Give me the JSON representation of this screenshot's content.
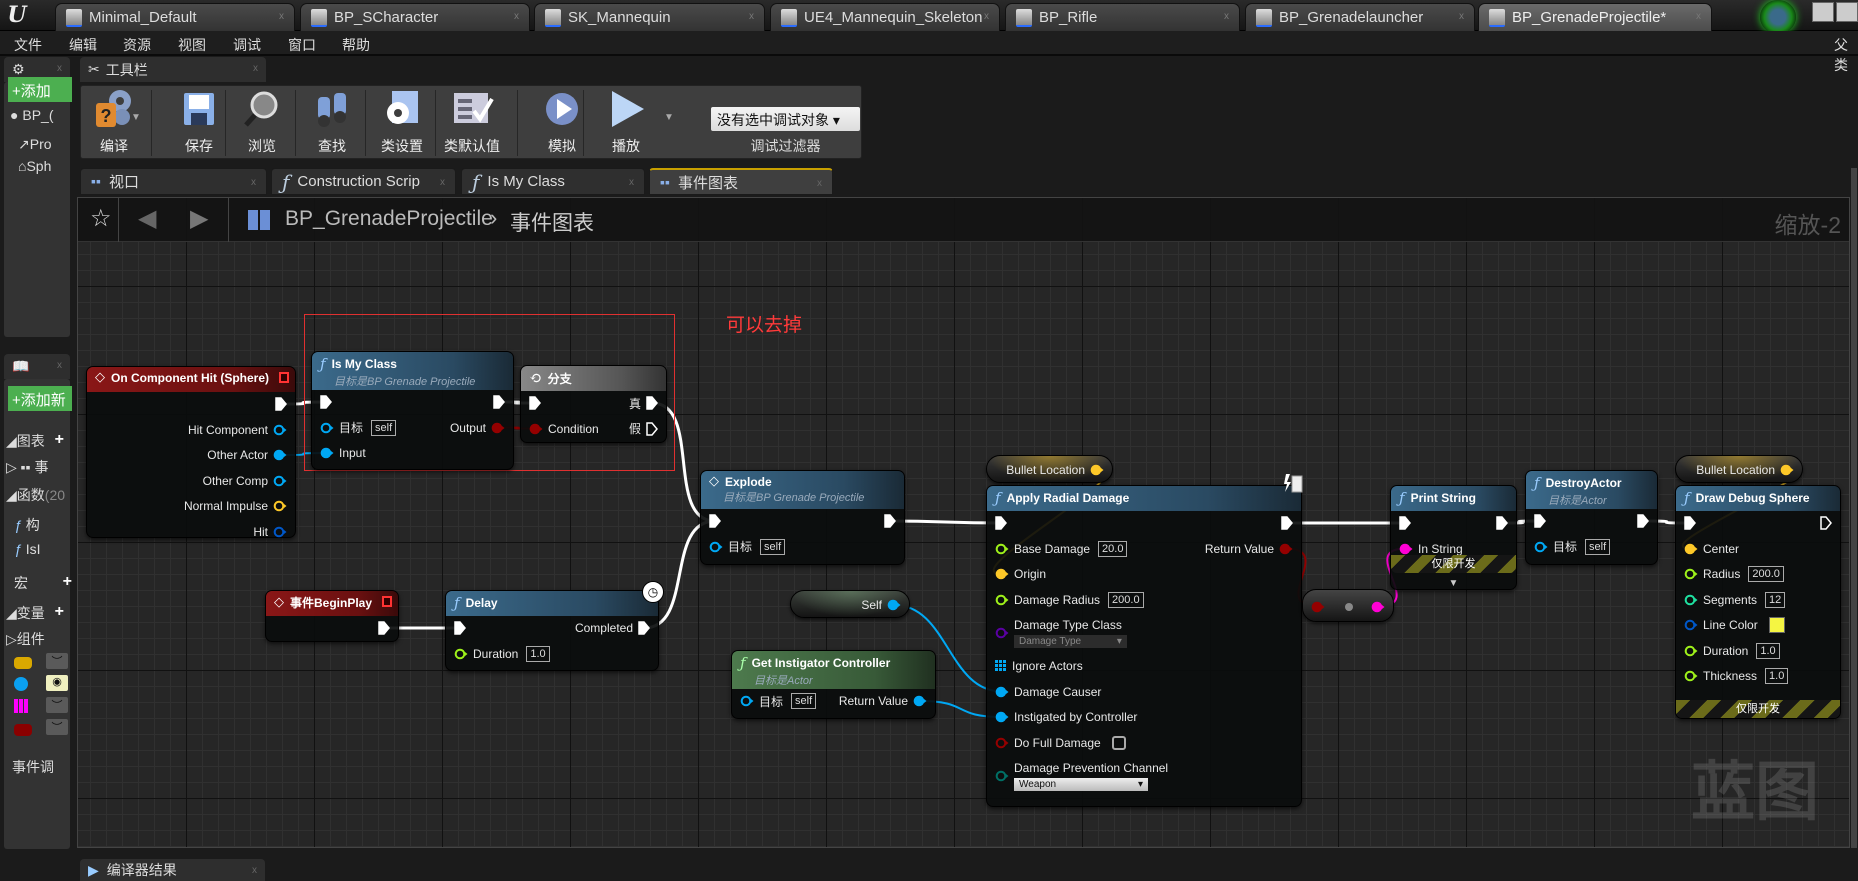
{
  "top_tabs": [
    {
      "label": "Minimal_Default",
      "icon": "level-icon"
    },
    {
      "label": "BP_SCharacter",
      "icon": "blueprint-icon"
    },
    {
      "label": "SK_Mannequin",
      "icon": "skeletal-mesh-icon"
    },
    {
      "label": "UE4_Mannequin_Skeleton",
      "icon": "skeleton-icon"
    },
    {
      "label": "BP_Rifle",
      "icon": "blueprint-icon"
    },
    {
      "label": "BP_Grenadelauncher",
      "icon": "blueprint-icon"
    },
    {
      "label": "BP_GrenadeProjectile*",
      "icon": "blueprint-icon",
      "active": true
    }
  ],
  "menu": [
    "文件",
    "编辑",
    "资源",
    "视图",
    "调试",
    "窗口",
    "帮助"
  ],
  "menu_right": "父类",
  "toolbar": {
    "tab": "工具栏",
    "buttons": [
      {
        "label": "编译",
        "icon": "compile-icon"
      },
      {
        "label": "保存",
        "icon": "save-icon"
      },
      {
        "label": "浏览",
        "icon": "browse-icon"
      },
      {
        "label": "查找",
        "icon": "find-icon"
      },
      {
        "label": "类设置",
        "icon": "class-settings-icon"
      },
      {
        "label": "类默认值",
        "icon": "class-defaults-icon"
      },
      {
        "label": "模拟",
        "icon": "simulate-icon"
      },
      {
        "label": "播放",
        "icon": "play-icon"
      }
    ],
    "debug_select": "没有选中调试对象",
    "debug_label": "调试过滤器"
  },
  "doc_tabs": [
    {
      "label": "视口",
      "icon": "viewport-icon"
    },
    {
      "label": "Construction Scrip",
      "icon": "function-icon"
    },
    {
      "label": "Is My Class",
      "icon": "function-icon"
    },
    {
      "label": "事件图表",
      "icon": "event-graph-icon",
      "active": true
    }
  ],
  "breadcrumb": {
    "blueprint": "BP_GrenadeProjectile",
    "separator": "›",
    "graph": "事件图表"
  },
  "zoom_label": "缩放-2",
  "watermark": "蓝图",
  "comment": "可以去掉",
  "left_panel": {
    "components": {
      "add": "+添加",
      "items": [
        "BP_(",
        "Pro",
        "Sph"
      ]
    },
    "my_blueprint": {
      "add": "+添加新",
      "graphs": "◢图表",
      "graph_item": "事",
      "functions": "◢函数",
      "functions_count": "(20",
      "function_items": [
        "构",
        "IsI"
      ],
      "macros": "宏",
      "variables": "◢变量",
      "components": "▷组件",
      "dispatchers": "事件调"
    }
  },
  "bottom_tab": "编译器结果",
  "pin_colors": {
    "exec": "#ffffff",
    "object": "#00a8f4",
    "struct": "#0057c8",
    "vector": "#fdc828",
    "float": "#9ef01a",
    "int": "#1fe0a0",
    "bool": "#950000",
    "string": "#ff00d4",
    "class": "#5a00a3",
    "enum": "#006f65",
    "array": "#00a8f4"
  },
  "graph": {
    "nodes": {
      "och": {
        "kind": "event",
        "title": "On Component Hit (Sphere)",
        "rows": [
          {
            "r": {
              "type": "exec"
            }
          },
          {
            "r": {
              "label": "Hit Component",
              "type": "object"
            }
          },
          {
            "r": {
              "label": "Other Actor",
              "type": "object"
            }
          },
          {
            "r": {
              "label": "Other Comp",
              "type": "object"
            }
          },
          {
            "r": {
              "label": "Normal Impulse",
              "type": "vector"
            }
          },
          {
            "r": {
              "label": "Hit",
              "type": "struct"
            }
          }
        ]
      },
      "imc": {
        "kind": "function",
        "title": "Is My Class",
        "subtitle": "目标是BP Grenade Projectile",
        "rows": [
          {
            "l": {
              "type": "exec"
            },
            "r": {
              "type": "exec"
            }
          },
          {
            "l": {
              "label": "目标",
              "type": "object",
              "value": "self"
            },
            "r": {
              "label": "Output",
              "type": "bool"
            }
          },
          {
            "l": {
              "label": "Input",
              "type": "object"
            }
          }
        ]
      },
      "branch": {
        "kind": "branch",
        "title": "分支",
        "rows": [
          {
            "l": {
              "type": "exec"
            },
            "r": {
              "label": "真",
              "type": "exec"
            }
          },
          {
            "l": {
              "label": "Condition",
              "type": "bool"
            },
            "r": {
              "label": "假",
              "type": "exec"
            }
          }
        ]
      },
      "explode": {
        "kind": "function",
        "icon": "event",
        "title": "Explode",
        "subtitle": "目标是BP Grenade Projectile",
        "rows": [
          {
            "l": {
              "type": "exec"
            },
            "r": {
              "type": "exec"
            }
          },
          {
            "l": {
              "label": "目标",
              "type": "object",
              "value": "self"
            }
          }
        ]
      },
      "beginplay": {
        "kind": "event",
        "title": "事件BeginPlay",
        "rows": [
          {
            "r": {
              "type": "exec"
            }
          }
        ]
      },
      "delay": {
        "kind": "function",
        "title": "Delay",
        "latent": true,
        "rows": [
          {
            "l": {
              "type": "exec"
            },
            "r": {
              "label": "Completed",
              "type": "exec"
            }
          },
          {
            "l": {
              "label": "Duration",
              "type": "float",
              "value": "1.0"
            }
          }
        ]
      },
      "self": {
        "kind": "var",
        "var_type": "object",
        "rows": [
          {
            "r": {
              "label": "Self",
              "type": "object"
            }
          }
        ]
      },
      "gic": {
        "kind": "pure",
        "title": "Get Instigator Controller",
        "subtitle": "目标是Actor",
        "rows": [
          {
            "l": {
              "label": "目标",
              "type": "object",
              "value": "self"
            },
            "r": {
              "label": "Return Value",
              "type": "object"
            }
          }
        ]
      },
      "bullet1": {
        "kind": "var",
        "var_type": "vector",
        "rows": [
          {
            "r": {
              "label": "Bullet Location",
              "type": "vector"
            }
          }
        ]
      },
      "ard": {
        "kind": "function",
        "title": "Apply Radial Damage",
        "authority_only": true,
        "rows": [
          {
            "l": {
              "type": "exec"
            },
            "r": {
              "type": "exec"
            }
          },
          {
            "l": {
              "label": "Base Damage",
              "type": "float",
              "value": "20.0"
            },
            "r": {
              "label": "Return Value",
              "type": "bool"
            }
          },
          {
            "l": {
              "label": "Origin",
              "type": "vector"
            }
          },
          {
            "l": {
              "label": "Damage Radius",
              "type": "float",
              "value": "200.0"
            }
          },
          {
            "l": {
              "label": "Damage Type Class",
              "type": "class",
              "dropdown": "Damage Type",
              "dim": true
            }
          },
          {
            "l": {
              "label": "Ignore Actors",
              "type": "array"
            }
          },
          {
            "l": {
              "label": "Damage Causer",
              "type": "object"
            }
          },
          {
            "l": {
              "label": "Instigated by Controller",
              "type": "object"
            }
          },
          {
            "l": {
              "label": "Do Full Damage",
              "type": "bool",
              "checkbox": false
            }
          },
          {
            "l": {
              "label": "Damage Prevention Channel",
              "type": "enum",
              "dropdown": "Weapon"
            }
          }
        ]
      },
      "reroute": {
        "kind": "conv",
        "rows": [
          {
            "l": {
              "type": "bool"
            },
            "r": {
              "type": "string"
            }
          }
        ]
      },
      "print": {
        "kind": "function",
        "title": "Print String",
        "footer": "仅限开发",
        "expand": true,
        "rows": [
          {
            "l": {
              "type": "exec"
            },
            "r": {
              "type": "exec"
            }
          },
          {
            "l": {
              "label": "In String",
              "type": "string"
            }
          }
        ]
      },
      "destroy": {
        "kind": "function",
        "title": "DestroyActor",
        "subtitle": "目标是Actor",
        "rows": [
          {
            "l": {
              "type": "exec"
            },
            "r": {
              "type": "exec"
            }
          },
          {
            "l": {
              "label": "目标",
              "type": "object",
              "value": "self"
            }
          }
        ]
      },
      "bullet2": {
        "kind": "var",
        "var_type": "vector",
        "rows": [
          {
            "r": {
              "label": "Bullet Location",
              "type": "vector"
            }
          }
        ]
      },
      "dds": {
        "kind": "function",
        "title": "Draw Debug Sphere",
        "footer": "仅限开发",
        "rows": [
          {
            "l": {
              "type": "exec"
            },
            "r": {
              "type": "exec"
            }
          },
          {
            "l": {
              "label": "Center",
              "type": "vector"
            }
          },
          {
            "l": {
              "label": "Radius",
              "type": "float",
              "value": "200.0"
            }
          },
          {
            "l": {
              "label": "Segments",
              "type": "int",
              "value": "12"
            }
          },
          {
            "l": {
              "label": "Line Color",
              "type": "struct",
              "color": "#f5f542"
            }
          },
          {
            "l": {
              "label": "Duration",
              "type": "float",
              "value": "1.0"
            }
          },
          {
            "l": {
              "label": "Thickness",
              "type": "float",
              "value": "1.0"
            }
          }
        ]
      }
    },
    "connections": [
      {
        "from": "och:0:r",
        "to": "imc:0:l",
        "type": "exec"
      },
      {
        "from": "och:2:r",
        "to": "imc:2:l",
        "type": "object"
      },
      {
        "from": "imc:0:r",
        "to": "branch:0:l",
        "type": "exec"
      },
      {
        "from": "imc:1:r",
        "to": "branch:1:l",
        "type": "bool"
      },
      {
        "from": "branch:0:r",
        "to": "explode:0:l",
        "type": "exec"
      },
      {
        "from": "beginplay:0:r",
        "to": "delay:0:l",
        "type": "exec"
      },
      {
        "from": "delay:0:r",
        "to": "explode:0:l",
        "type": "exec"
      },
      {
        "from": "explode:0:r",
        "to": "ard:0:l",
        "type": "exec"
      },
      {
        "from": "bullet1:0:r",
        "to": "ard:2:l",
        "type": "vector"
      },
      {
        "from": "self:0:r",
        "to": "ard:6:l",
        "type": "object"
      },
      {
        "from": "gic:0:r",
        "to": "ard:7:l",
        "type": "object"
      },
      {
        "from": "ard:0:r",
        "to": "print:0:l",
        "type": "exec"
      },
      {
        "from": "ard:1:r",
        "to": "reroute:0:l",
        "type": "bool"
      },
      {
        "from": "reroute:0:r",
        "to": "print:1:l",
        "type": "string"
      },
      {
        "from": "print:0:r",
        "to": "destroy:0:l",
        "type": "exec"
      },
      {
        "from": "destroy:0:r",
        "to": "dds:0:l",
        "type": "exec"
      },
      {
        "from": "bullet2:0:r",
        "to": "dds:1:l",
        "type": "vector"
      }
    ]
  }
}
